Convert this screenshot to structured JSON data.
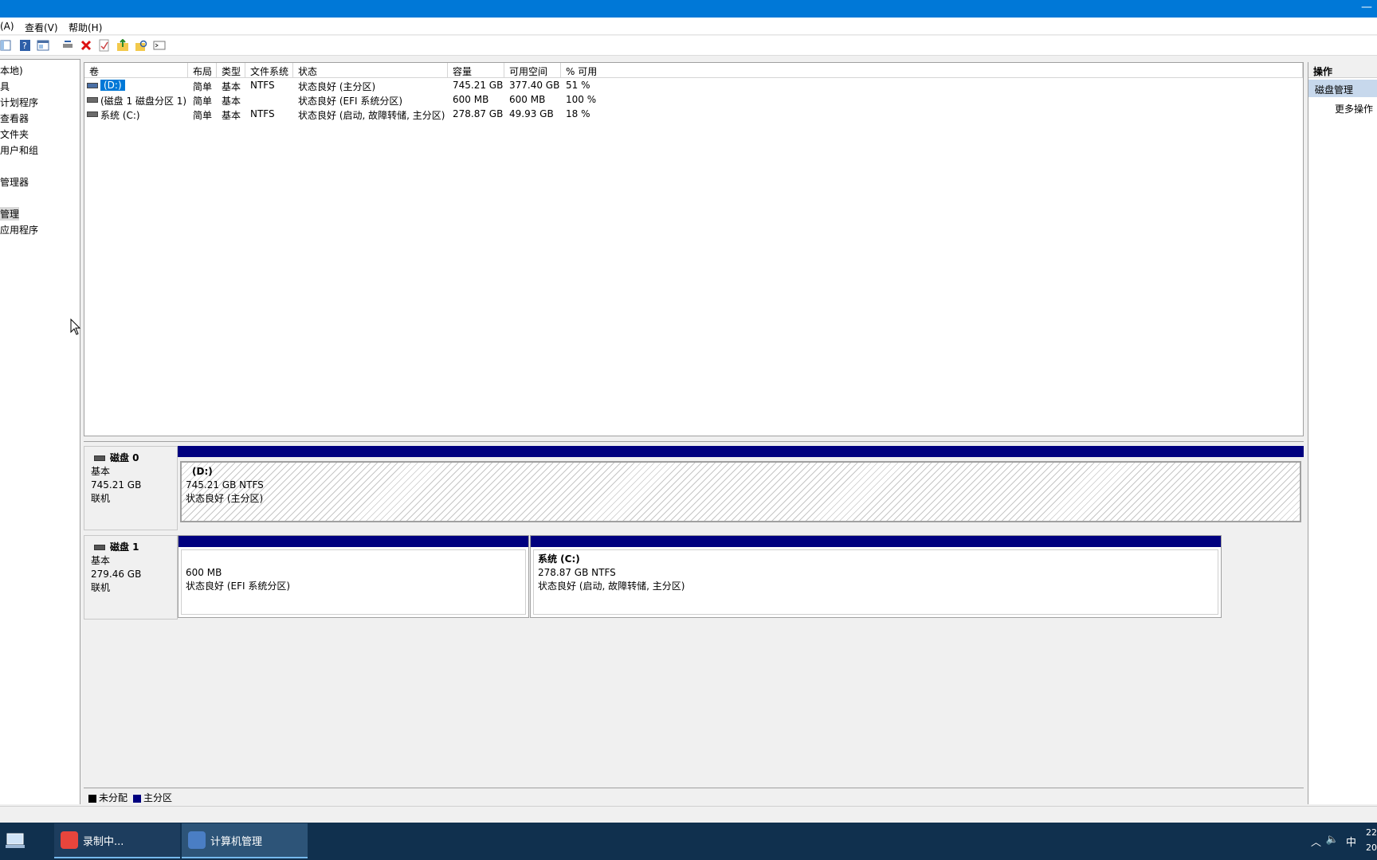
{
  "menu": {
    "items": [
      "(A)",
      "查看(V)",
      "帮助(H)"
    ]
  },
  "tree": {
    "items": [
      "本地)",
      "具",
      "计划程序",
      "查看器",
      "文件夹",
      "用户和组",
      "",
      "管理器",
      "",
      "管理",
      "应用程序"
    ],
    "selected_index": 9
  },
  "volumes": {
    "columns": [
      "卷",
      "布局",
      "类型",
      "文件系统",
      "状态",
      "容量",
      "可用空间",
      "% 可用"
    ],
    "rows": [
      {
        "name": "(D:)",
        "layout": "简单",
        "type": "基本",
        "fs": "NTFS",
        "status": "状态良好 (主分区)",
        "capacity": "745.21 GB",
        "free": "377.40 GB",
        "pct": "51 %"
      },
      {
        "name": "(磁盘 1 磁盘分区 1)",
        "layout": "简单",
        "type": "基本",
        "fs": "",
        "status": "状态良好 (EFI 系统分区)",
        "capacity": "600 MB",
        "free": "600 MB",
        "pct": "100 %"
      },
      {
        "name": "系统 (C:)",
        "layout": "简单",
        "type": "基本",
        "fs": "NTFS",
        "status": "状态良好 (启动, 故障转储, 主分区)",
        "capacity": "278.87 GB",
        "free": "49.93 GB",
        "pct": "18 %"
      }
    ]
  },
  "disks": [
    {
      "name": "磁盘 0",
      "type": "基本",
      "size": "745.21 GB",
      "state": "联机",
      "partitions": [
        {
          "label": "(D:)",
          "size": "745.21 GB NTFS",
          "status": "状态良好 (主分区)"
        }
      ]
    },
    {
      "name": "磁盘 1",
      "type": "基本",
      "size": "279.46 GB",
      "state": "联机",
      "partitions": [
        {
          "label": "",
          "size": "600 MB",
          "status": "状态良好 (EFI 系统分区)"
        },
        {
          "label": "系统  (C:)",
          "size": "278.87 GB NTFS",
          "status": "状态良好 (启动, 故障转储, 主分区)"
        }
      ]
    }
  ],
  "legend": {
    "unallocated": "未分配",
    "primary": "主分区",
    "unallocated_color": "#000000",
    "primary_color": "#00007f"
  },
  "actions": {
    "title": "操作",
    "section": "磁盘管理",
    "more": "更多操作"
  },
  "taskbar": {
    "tasks": [
      {
        "label": "录制中...",
        "icon": "recorder-icon",
        "color": "#e8453c"
      },
      {
        "label": "计算机管理",
        "icon": "computer-management-icon",
        "color": "#4a7ec4"
      }
    ],
    "clock_time": "22",
    "clock_date": "20",
    "ime": "中"
  },
  "colors": {
    "titlebar": "#0078d7",
    "partition_bar": "#00007f",
    "taskbar": "#10304e"
  }
}
